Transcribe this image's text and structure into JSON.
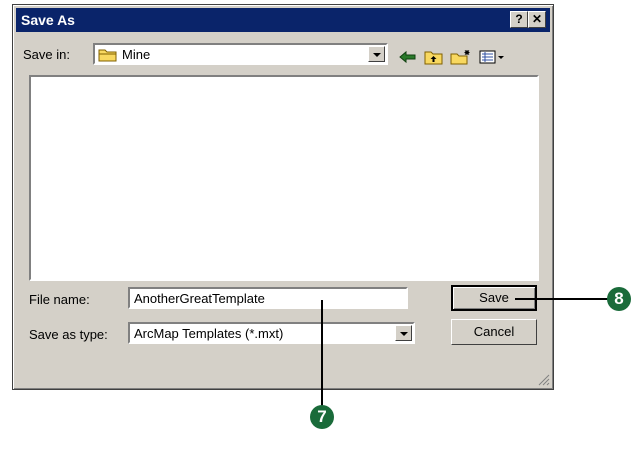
{
  "window": {
    "title": "Save As",
    "help_glyph": "?",
    "close_glyph": "✕"
  },
  "toolbar": {
    "save_in_label": "Save in:",
    "save_in_value": "Mine",
    "icons": [
      "folder-icon",
      "back-icon",
      "up-one-level-icon",
      "new-folder-icon",
      "view-menu-icon"
    ]
  },
  "form": {
    "file_name_label": "File name:",
    "file_name_value": "AnotherGreatTemplate",
    "save_as_type_label": "Save as type:",
    "save_as_type_value": "ArcMap Templates (*.mxt)"
  },
  "buttons": {
    "save": "Save",
    "cancel": "Cancel"
  },
  "callouts": {
    "file_name_step": "7",
    "save_step": "8"
  },
  "colors": {
    "titlebar": "#0a246a",
    "dialog_face": "#d4d0c8",
    "callout": "#1a6b3a"
  }
}
